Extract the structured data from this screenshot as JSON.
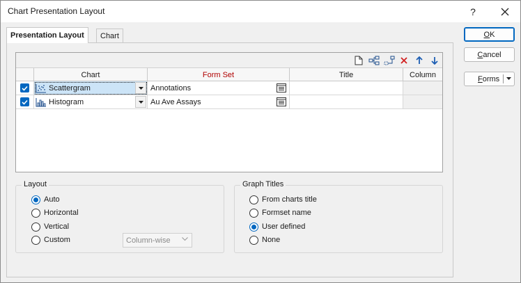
{
  "window": {
    "title": "Chart Presentation Layout",
    "help_label": "?"
  },
  "tabs": [
    {
      "label": "Presentation Layout",
      "active": true
    },
    {
      "label": "Chart",
      "active": false
    }
  ],
  "grid": {
    "toolbar_icons": [
      "new-row-icon",
      "insert-row-icon",
      "append-row-icon",
      "delete-row-icon",
      "move-up-icon",
      "move-down-icon"
    ],
    "columns": [
      "Chart",
      "Form Set",
      "Title",
      "Column"
    ],
    "rows": [
      {
        "checked": true,
        "chart": "Scattergram",
        "chart_icon": "scattergram-icon",
        "form_set": "Annotations",
        "title": "",
        "column": "",
        "selected": true
      },
      {
        "checked": true,
        "chart": "Histogram",
        "chart_icon": "histogram-icon",
        "form_set": "Au Ave Assays",
        "title": "",
        "column": "",
        "selected": false
      }
    ]
  },
  "layout": {
    "title": "Layout",
    "options": [
      {
        "label": "Auto",
        "checked": true
      },
      {
        "label": "Horizontal",
        "checked": false
      },
      {
        "label": "Vertical",
        "checked": false
      },
      {
        "label": "Custom",
        "checked": false
      }
    ],
    "custom_combo": "Column-wise"
  },
  "graph_titles": {
    "title": "Graph Titles",
    "options": [
      {
        "label": "From charts title",
        "checked": false
      },
      {
        "label": "Formset name",
        "checked": false
      },
      {
        "label": "User defined",
        "checked": true
      },
      {
        "label": "None",
        "checked": false
      }
    ]
  },
  "buttons": {
    "ok_first": "O",
    "ok_rest": "K",
    "cancel_first": "C",
    "cancel_rest": "ancel",
    "forms_first": "F",
    "forms_rest": "orms"
  },
  "colors": {
    "accent": "#0067c0",
    "required_header": "#b00000",
    "selection": "#cce4f7"
  }
}
